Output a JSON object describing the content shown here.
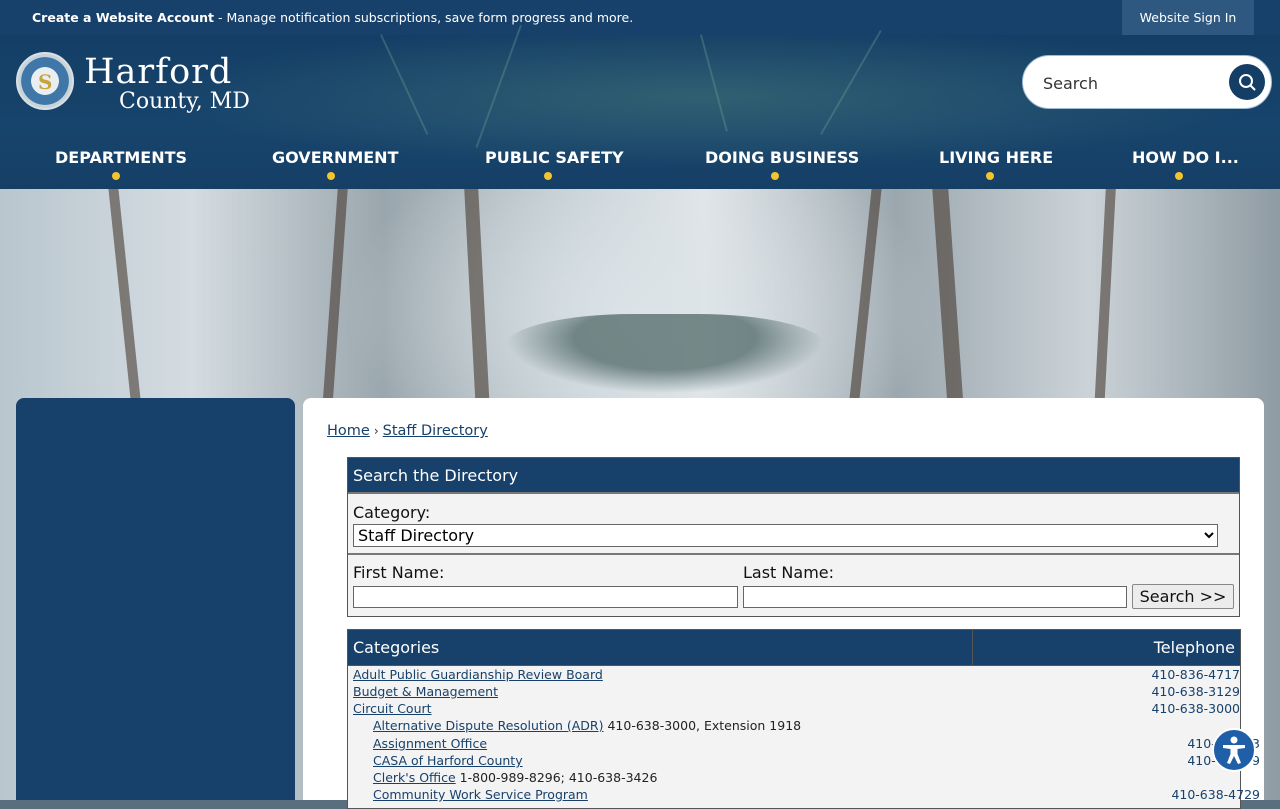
{
  "topbar": {
    "create_account": "Create a Website Account",
    "message": " - Manage notification subscriptions, save form progress and more.",
    "signin": "Website Sign In"
  },
  "logo": {
    "line1": "Harford",
    "line2": "County, MD",
    "seal_letter": "S"
  },
  "search": {
    "placeholder": "Search"
  },
  "nav": [
    "DEPARTMENTS",
    "GOVERNMENT",
    "PUBLIC SAFETY",
    "DOING BUSINESS",
    "LIVING HERE",
    "HOW DO I..."
  ],
  "breadcrumb": {
    "home": "Home",
    "sep": "›",
    "current": "Staff Directory"
  },
  "directory": {
    "title": "Search the Directory",
    "category_label": "Category:",
    "category_selected": "Staff Directory",
    "first_name_label": "First Name:",
    "last_name_label": "Last Name:",
    "search_button": "Search >>"
  },
  "table": {
    "col_categories": "Categories",
    "col_telephone": "Telephone",
    "rows": [
      {
        "name": "Adult Public Guardianship Review Board",
        "extra": "",
        "phone": "410-836-4717",
        "indent": false
      },
      {
        "name": "Budget & Management",
        "extra": "",
        "phone": "410-638-3129",
        "indent": false
      },
      {
        "name": "Circuit Court",
        "extra": "",
        "phone": "410-638-3000",
        "indent": false
      },
      {
        "name": "Alternative Dispute Resolution (ADR)",
        "extra": " 410-638-3000, Extension 1918",
        "phone": "",
        "indent": true
      },
      {
        "name": "Assignment Office",
        "extra": "",
        "phone": "410-638-33",
        "indent": true
      },
      {
        "name": "CASA of Harford County",
        "extra": "",
        "phone": "410-638-49",
        "indent": true
      },
      {
        "name": "Clerk's Office",
        "extra": " 1-800-989-8296; 410-638-3426",
        "phone": "",
        "indent": true
      },
      {
        "name": "Community Work Service Program",
        "extra": "",
        "phone": "410-638-4729",
        "indent": true
      }
    ]
  },
  "colors": {
    "navy": "#17416b",
    "accent_dot": "#f4c42c",
    "a11y": "#1f5fa8"
  }
}
